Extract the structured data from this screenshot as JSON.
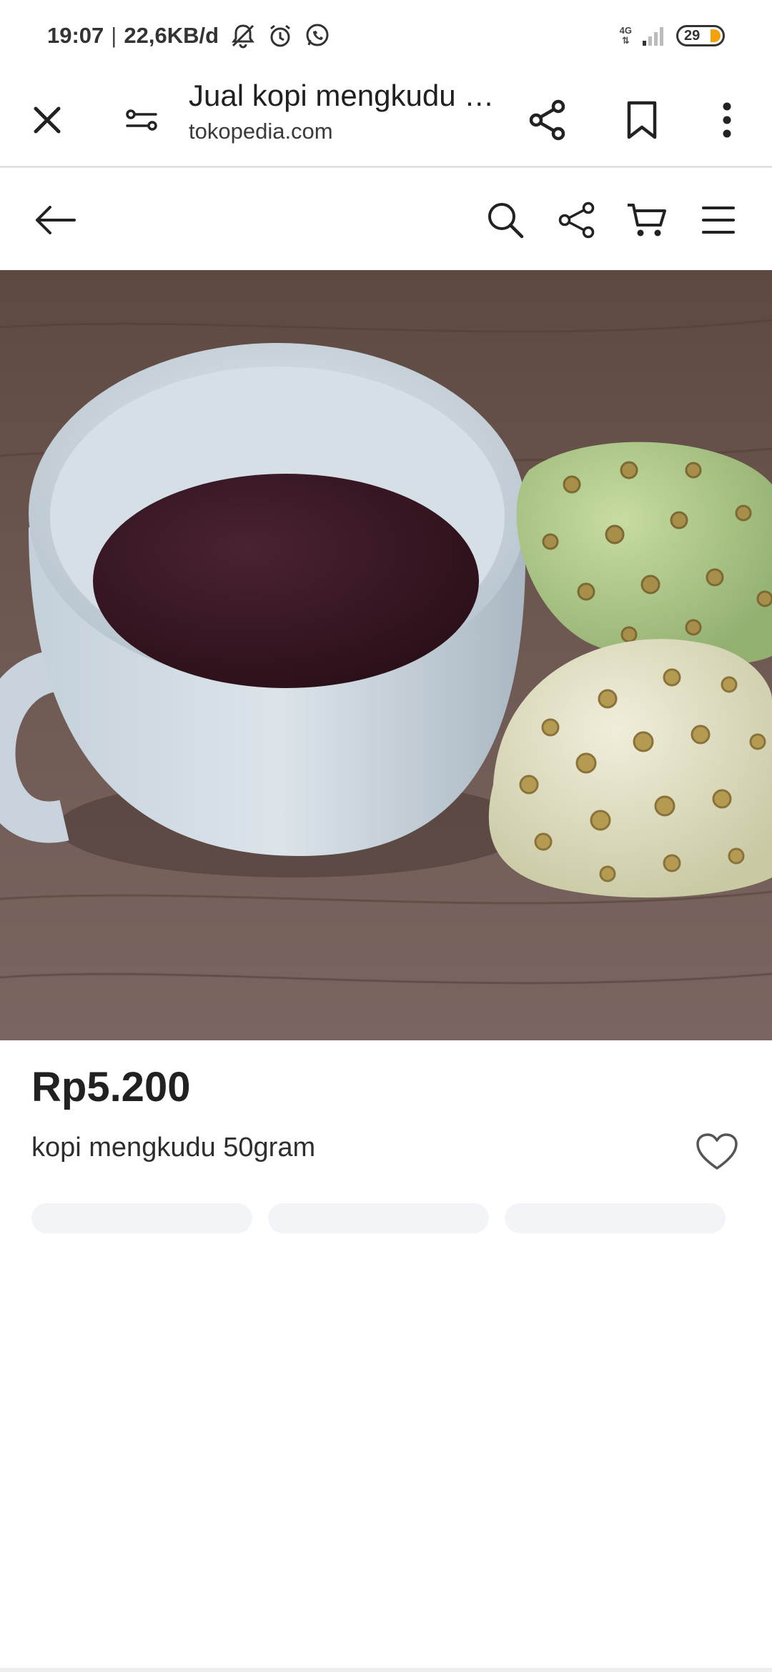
{
  "status_bar": {
    "time": "19:07",
    "separator": "|",
    "data_rate": "22,6KB/d",
    "icons": [
      "muted-notification-icon",
      "alarm-icon",
      "whatsapp-icon",
      "network-4g-icon",
      "signal-icon",
      "battery-icon"
    ],
    "network_type": "4G",
    "battery_level": "29",
    "battery_color": "#f2a20d"
  },
  "browser_toolbar": {
    "page_title": "Jual kopi mengkudu …",
    "domain": "tokopedia.com",
    "icons": [
      "close-icon",
      "site-settings-icon",
      "share-icon",
      "bookmark-icon",
      "more-icon"
    ]
  },
  "site_header": {
    "icons": [
      "back-arrow-icon",
      "search-icon",
      "share-icon",
      "cart-icon",
      "menu-icon"
    ]
  },
  "product": {
    "image_subject": "white cup of noni coffee with two noni fruits on a wooden table",
    "price": "Rp5.200",
    "name": "kopi mengkudu 50gram",
    "wishlist_icon": "heart-icon",
    "loading_placeholders": 3
  }
}
